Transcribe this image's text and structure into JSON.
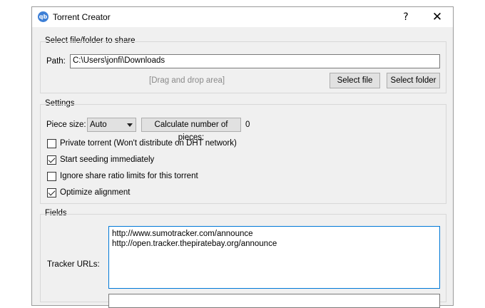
{
  "window": {
    "title": "Torrent Creator",
    "app_icon_text": "qb",
    "help_glyph": "?",
    "close_glyph": "✕"
  },
  "share_group": {
    "title": "Select file/folder to share",
    "path_label": "Path:",
    "path_value": "C:\\Users\\jonfi\\Downloads",
    "drag_hint": "[Drag and drop area]",
    "select_file_label": "Select file",
    "select_folder_label": "Select folder"
  },
  "settings_group": {
    "title": "Settings",
    "piece_size_label": "Piece size:",
    "piece_size_value": "Auto",
    "calc_button_label": "Calculate number of pieces:",
    "pieces_count": "0",
    "checkboxes": [
      {
        "label": "Private torrent (Won't distribute on DHT network)",
        "checked": false
      },
      {
        "label": "Start seeding immediately",
        "checked": true
      },
      {
        "label": "Ignore share ratio limits for this torrent",
        "checked": false
      },
      {
        "label": "Optimize alignment",
        "checked": true
      }
    ]
  },
  "fields_group": {
    "title": "Fields",
    "tracker_urls_label": "Tracker URLs:",
    "tracker_urls_value": "http://www.sumotracker.com/announce\nhttp://open.tracker.thepiratebay.org/announce"
  }
}
